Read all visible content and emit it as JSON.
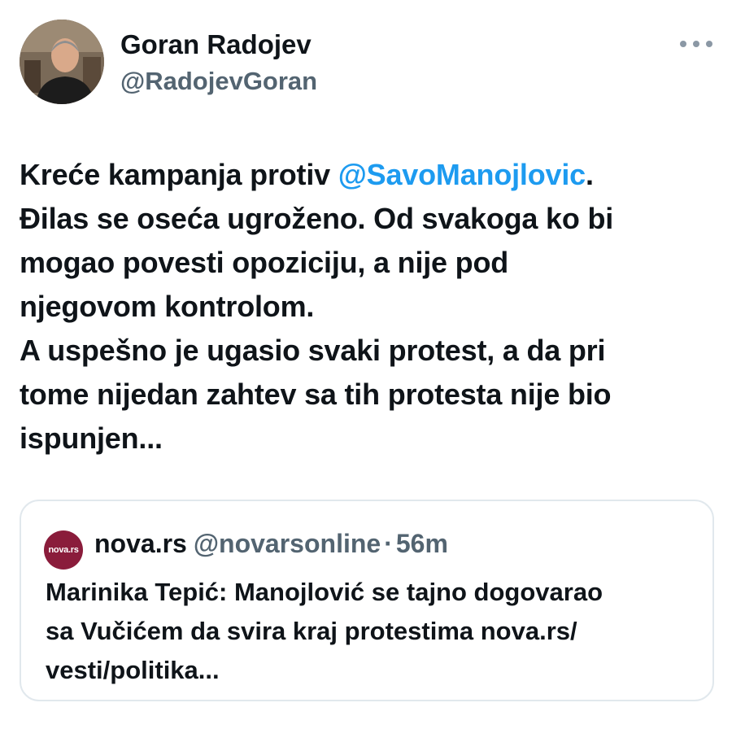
{
  "author": {
    "display_name": "Goran Radojev",
    "handle": "@RadojevGoran"
  },
  "tweet": {
    "lines": [
      {
        "before": "Kreće kampanja protiv ",
        "mention": "@SavoManojlovic",
        "after": "."
      },
      {
        "text": "Đilas se oseća ugroženo. Od svakoga ko bi"
      },
      {
        "text": "mogao povesti opoziciju, a nije pod"
      },
      {
        "text": "njegovom kontrolom."
      },
      {
        "text": "A uspešno je ugasio svaki protest, a da pri"
      },
      {
        "text": "tome nijedan zahtev sa tih protesta nije bio"
      },
      {
        "text": "ispunjen..."
      }
    ]
  },
  "quoted_tweet": {
    "avatar_text": "nova.rs",
    "name": "nova.rs",
    "handle": "@novarsonline",
    "separator": "·",
    "time": "56m",
    "lines": [
      "Marinika Tepić: Manojlović se tajno dogovarao",
      "sa Vučićem da svira kraj protestima nova.rs/",
      "vesti/politika..."
    ]
  },
  "icons": {
    "more": "more-horizontal-icon"
  },
  "colors": {
    "mention": "#1d9bf0",
    "text": "#0f1419",
    "secondary": "#536471",
    "nova_brand": "#8a1c3b"
  }
}
